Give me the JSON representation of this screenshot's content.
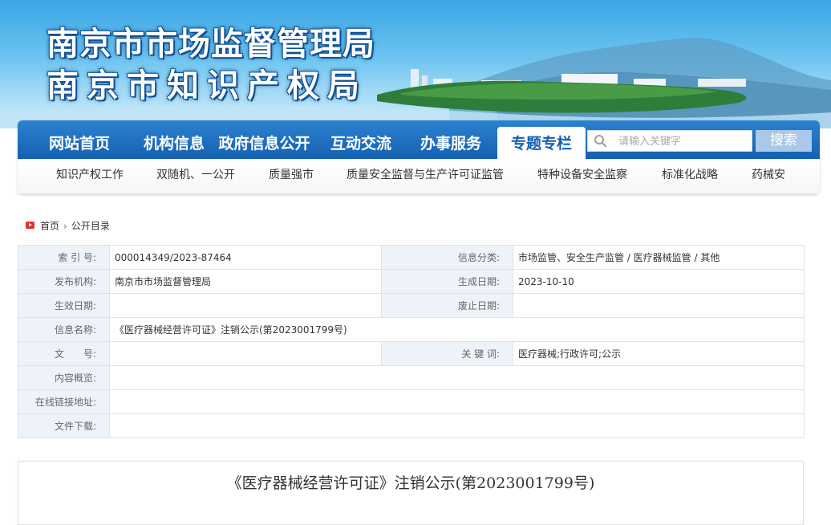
{
  "banner": {
    "title_line1": "南京市市场监督管理局",
    "title_line2": "南京市知识产权局"
  },
  "nav": {
    "items": [
      "网站首页",
      "机构信息",
      "政府信息公开",
      "互动交流",
      "办事服务",
      "专题专栏"
    ],
    "active_item": "专题专栏",
    "search_placeholder": "请输入关键字",
    "search_button": "搜索",
    "sub_items": [
      "知识产权工作",
      "双随机、一公开",
      "质量强市",
      "质量安全监督与生产许可证监管",
      "特种设备安全监察",
      "标准化战略",
      "药械安"
    ]
  },
  "breadcrumb": [
    "首页",
    "公开目录"
  ],
  "info": {
    "index_label": "索 引 号:",
    "index_value": "000014349/2023-87464",
    "category_label": "信息分类:",
    "category_value": "市场监管、安全生产监管 / 医疗器械监管 / 其他",
    "publisher_label": "发布机构:",
    "publisher_value": "南京市市场监督管理局",
    "created_label": "生成日期:",
    "created_value": "2023-10-10",
    "effective_label": "生效日期:",
    "effective_value": "",
    "expiry_label": "废止日期:",
    "expiry_value": "",
    "name_label": "信息名称:",
    "name_value": "《医疗器械经营许可证》注销公示(第2023001799号)",
    "docno_label": "文　　号:",
    "docno_value": "",
    "keywords_label": "关 键 词:",
    "keywords_value": "医疗器械;行政许可;公示",
    "summary_label": "内容概览:",
    "summary_value": "",
    "link_label": "在线链接地址:",
    "link_value": "",
    "download_label": "文件下载:",
    "download_value": ""
  },
  "article": {
    "title": "《医疗器械经营许可证》注销公示(第2023001799号)"
  },
  "colors": {
    "nav_blue": "#1560b0",
    "label_bg": "#eef3fa",
    "border": "#d9e4f0",
    "home_icon_red": "#e2322b"
  }
}
